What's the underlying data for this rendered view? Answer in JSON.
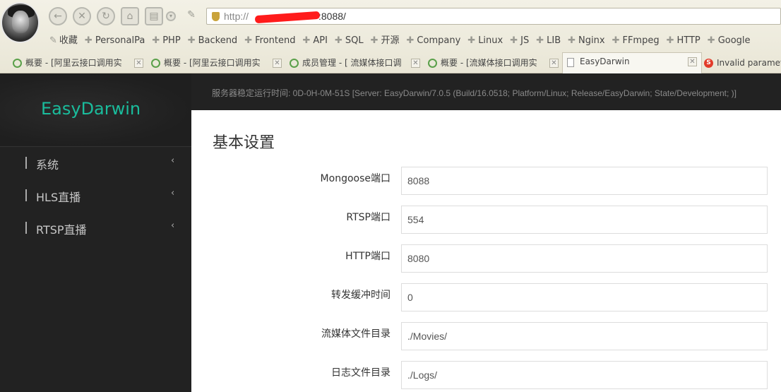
{
  "browser": {
    "url_prefix": "http://",
    "url_port": ":8088/",
    "bookmarks": [
      {
        "label": "收藏",
        "kind": "pin"
      },
      {
        "label": "PersonalPa",
        "kind": "plus"
      },
      {
        "label": "PHP",
        "kind": "plus"
      },
      {
        "label": "Backend",
        "kind": "plus"
      },
      {
        "label": "Frontend",
        "kind": "plus"
      },
      {
        "label": "API",
        "kind": "plus"
      },
      {
        "label": "SQL",
        "kind": "plus"
      },
      {
        "label": "开源",
        "kind": "plus"
      },
      {
        "label": "Company",
        "kind": "plus"
      },
      {
        "label": "Linux",
        "kind": "plus"
      },
      {
        "label": "JS",
        "kind": "plus"
      },
      {
        "label": "LIB",
        "kind": "plus"
      },
      {
        "label": "Nginx",
        "kind": "plus"
      },
      {
        "label": "FFmpeg",
        "kind": "plus"
      },
      {
        "label": "HTTP",
        "kind": "plus"
      },
      {
        "label": "Google",
        "kind": "plus"
      }
    ],
    "tabs": [
      {
        "label": "概要 - [阿里云接口调用实"
      },
      {
        "label": "概要 - [阿里云接口调用实"
      },
      {
        "label": "成员管理 - [ 流媒体接口调"
      },
      {
        "label": "概要 - [流媒体接口调用实"
      },
      {
        "label": "EasyDarwin"
      },
      {
        "label": "Invalid paramet"
      }
    ]
  },
  "sidebar": {
    "brand": "EasyDarwin",
    "items": [
      {
        "label": "系统"
      },
      {
        "label": "HLS直播"
      },
      {
        "label": "RTSP直播"
      }
    ]
  },
  "topbar": {
    "status": "服务器稳定运行时间: 0D-0H-0M-51S [Server: EasyDarwin/7.0.5 (Build/16.0518; Platform/Linux; Release/EasyDarwin; State/Development; )]"
  },
  "main": {
    "title": "基本设置",
    "fields": [
      {
        "label": "Mongoose端口",
        "value": "8088"
      },
      {
        "label": "RTSP端口",
        "value": "554"
      },
      {
        "label": "HTTP端口",
        "value": "8080"
      },
      {
        "label": "转发缓冲时间",
        "value": "0"
      },
      {
        "label": "流媒体文件目录",
        "value": "./Movies/"
      },
      {
        "label": "日志文件目录",
        "value": "./Logs/"
      }
    ]
  },
  "colors": {
    "brand": "#1abc9c",
    "sidebar_bg": "#222222",
    "url_redaction": "#ff1b1b"
  }
}
